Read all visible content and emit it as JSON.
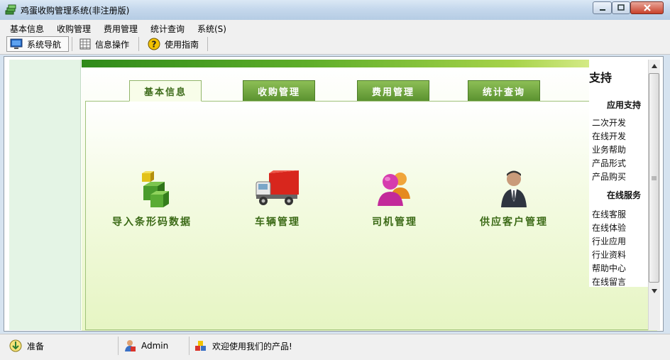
{
  "window": {
    "title": "鸡蛋收购管理系统(非注册版)",
    "icon": "money-stack-icon",
    "controls": {
      "minimize": "minimize-icon",
      "maximize": "maximize-icon",
      "close": "close-icon"
    }
  },
  "menubar": {
    "items": [
      {
        "label": "基本信息"
      },
      {
        "label": "收购管理"
      },
      {
        "label": "费用管理"
      },
      {
        "label": "统计查询"
      },
      {
        "label": "系统(S)"
      }
    ]
  },
  "toolbar": {
    "items": [
      {
        "label": "系统导航",
        "icon": "monitor-icon"
      },
      {
        "label": "信息操作",
        "icon": "grid-icon"
      },
      {
        "label": "使用指南",
        "icon": "help-icon"
      }
    ]
  },
  "tabs": [
    {
      "label": "基本信息",
      "active": true
    },
    {
      "label": "收购管理",
      "active": false
    },
    {
      "label": "费用管理",
      "active": false
    },
    {
      "label": "统计查询",
      "active": false
    }
  ],
  "features": [
    {
      "label": "导入条形码数据",
      "icon": "cubes-icon"
    },
    {
      "label": "车辆管理",
      "icon": "truck-icon"
    },
    {
      "label": "司机管理",
      "icon": "people-icon"
    },
    {
      "label": "供应客户管理",
      "icon": "businessman-icon"
    }
  ],
  "support": {
    "title": "支持",
    "sections": [
      {
        "title": "应用支持",
        "links": [
          "二次开发",
          "在线开发",
          "业务帮助",
          "产品形式",
          "产品购买"
        ]
      },
      {
        "title": "在线服务",
        "links": [
          "在线客服",
          "在线体验",
          "行业应用",
          "行业资料",
          "帮助中心",
          "在线留言"
        ]
      }
    ]
  },
  "statusbar": {
    "status": "准备",
    "user": "Admin",
    "message": "欢迎使用我们的产品!"
  },
  "colors": {
    "accent_green": "#5b9230",
    "label_green": "#3b6a16",
    "title_bar": "#c5d8ec"
  }
}
